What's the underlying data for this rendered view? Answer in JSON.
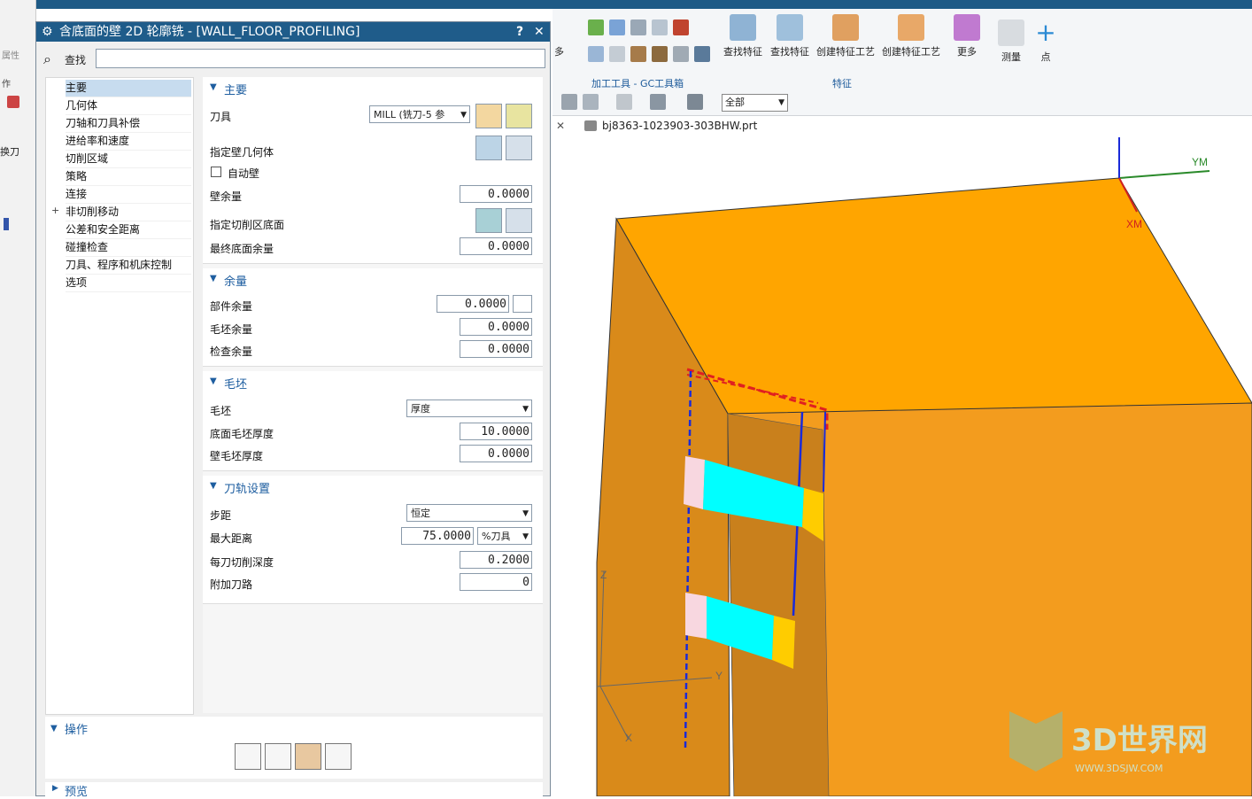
{
  "dialog": {
    "title": "含底面的壁 2D 轮廓铣 - [WALL_FLOOR_PROFILING]",
    "help_label": "?",
    "close_label": "✕",
    "search_label": "查找",
    "search_value": ""
  },
  "nav": {
    "items": [
      {
        "label": "主要",
        "selected": true
      },
      {
        "label": "几何体"
      },
      {
        "label": "刀轴和刀具补偿"
      },
      {
        "label": "进给率和速度"
      },
      {
        "label": "切削区域"
      },
      {
        "label": "策略"
      },
      {
        "label": "连接"
      },
      {
        "label": "非切削移动",
        "expander": "+"
      },
      {
        "label": "公差和安全距离"
      },
      {
        "label": "碰撞检查"
      },
      {
        "label": "刀具、程序和机床控制"
      },
      {
        "label": "选项"
      }
    ]
  },
  "main_section": {
    "header": "主要",
    "tool_label": "刀具",
    "tool_value": "MILL (铣刀-5 参",
    "wall_geom_label": "指定壁几何体",
    "auto_wall_label": "自动壁",
    "auto_wall_checked": false,
    "wall_stock_label": "壁余量",
    "wall_stock_value": "0.0000",
    "floor_label": "指定切削区底面",
    "final_floor_label": "最终底面余量",
    "final_floor_value": "0.0000"
  },
  "stock_section": {
    "header": "余量",
    "part_label": "部件余量",
    "part_value": "0.0000",
    "blank_label": "毛坯余量",
    "blank_value": "0.0000",
    "check_label": "检查余量",
    "check_value": "0.0000"
  },
  "blank_section": {
    "header": "毛坯",
    "blank_label": "毛坯",
    "blank_value": "厚度",
    "floor_thick_label": "底面毛坯厚度",
    "floor_thick_value": "10.0000",
    "wall_thick_label": "壁毛坯厚度",
    "wall_thick_value": "0.0000"
  },
  "path_section": {
    "header": "刀轨设置",
    "step_label": "步距",
    "step_value": "恒定",
    "maxdist_label": "最大距离",
    "maxdist_value": "75.0000",
    "maxdist_unit": "%刀具",
    "depth_label": "每刀切削深度",
    "depth_value": "0.2000",
    "extra_label": "附加刀路",
    "extra_value": "0"
  },
  "operations": {
    "header": "操作"
  },
  "preview": {
    "header": "预览"
  },
  "ribbon": {
    "find_feature_1": "查找特征",
    "find_feature_2": "查找特征",
    "create_feature_process_1": "创建特征工艺",
    "create_feature_process_2": "创建特征工艺",
    "more": "更多",
    "measure": "测量",
    "point": "点",
    "group_machining_tools": "加工工具 - GC工具箱",
    "group_feature": "特征",
    "filter_value": "全部",
    "left_more": "多",
    "left_attr": "属性",
    "left_ops": "作",
    "left_change_tool": "换刀"
  },
  "viewport": {
    "file_tab": "bj8363-1023903-303BHW.prt",
    "axis_ym": "YM",
    "axis_xm": "XM",
    "axis_y": "Y",
    "axis_x": "X",
    "axis_z": "Z",
    "watermark_title": "3D世界网",
    "watermark_url": "WWW.3DSJW.COM"
  },
  "colors": {
    "title_bar": "#1f5c8a",
    "section_header": "#1e5ea0",
    "part_orange": "#f7a21b",
    "part_dark_orange": "#d8891a",
    "tool_cyan": "#00ffff",
    "tool_yellow": "#ffcc00",
    "tool_pink": "#f8d7e0"
  }
}
